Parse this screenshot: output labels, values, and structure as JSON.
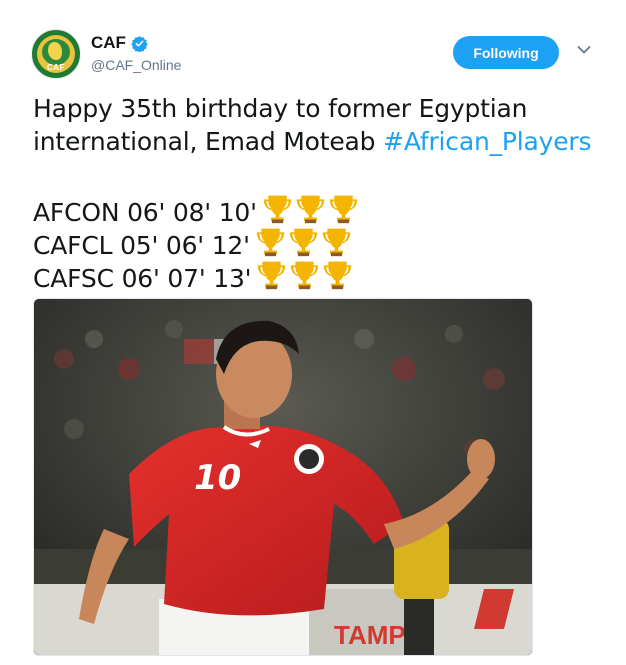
{
  "user": {
    "display_name": "CAF",
    "handle": "@CAF_Online",
    "verified": true,
    "avatar_label": "CAF"
  },
  "follow_button": {
    "label": "Following"
  },
  "tweet": {
    "line1": "Happy 35th birthday to former Egyptian",
    "line2_text": "international, Emad Moteab ",
    "hashtag": "#African_Players",
    "competitions": [
      {
        "label": "AFCON 06' 08' 10'",
        "trophies": 3
      },
      {
        "label": "CAFCL 05' 06' 12'",
        "trophies": 3
      },
      {
        "label": "CAFSC 06' 07' 13'",
        "trophies": 3
      }
    ]
  },
  "media": {
    "jersey_number": "10"
  },
  "colors": {
    "accent": "#1da1f2",
    "text": "#14171a",
    "secondary_text": "#657786",
    "trophy": "#f4b400"
  }
}
